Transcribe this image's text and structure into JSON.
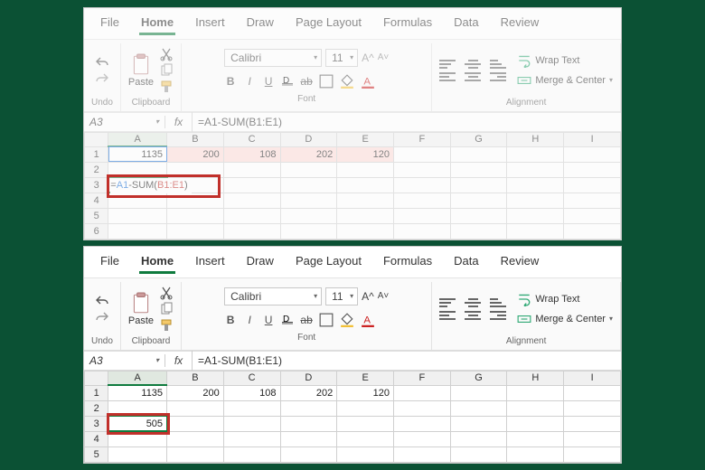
{
  "menu": {
    "file": "File",
    "home": "Home",
    "insert": "Insert",
    "draw": "Draw",
    "page_layout": "Page Layout",
    "formulas": "Formulas",
    "data": "Data",
    "review": "Review"
  },
  "groups": {
    "undo": "Undo",
    "clipboard": "Clipboard",
    "font": "Font",
    "alignment": "Alignment"
  },
  "paste_label": "Paste",
  "font": {
    "name": "Calibri",
    "size": "11",
    "bold": "B",
    "italic": "I",
    "underline": "U"
  },
  "wrap_text": "Wrap Text",
  "merge_center": "Merge & Center",
  "top": {
    "namebox": "A3",
    "formula": "=A1-SUM(B1:E1)",
    "edit_tokens": {
      "eq": "=",
      "ref1": "A1",
      "mid": "-SUM(",
      "ref2": "B1:E1",
      "end": ")"
    },
    "row1": {
      "A": "1135",
      "B": "200",
      "C": "108",
      "D": "202",
      "E": "120"
    }
  },
  "bottom": {
    "namebox": "A3",
    "formula": "=A1-SUM(B1:E1)",
    "row1": {
      "A": "1135",
      "B": "200",
      "C": "108",
      "D": "202",
      "E": "120"
    },
    "result": "505"
  },
  "cols": [
    "A",
    "B",
    "C",
    "D",
    "E",
    "F",
    "G",
    "H",
    "I"
  ],
  "rows_top": [
    "1",
    "2",
    "3",
    "4",
    "5",
    "6"
  ],
  "rows_bottom": [
    "1",
    "2",
    "3",
    "4",
    "5"
  ]
}
